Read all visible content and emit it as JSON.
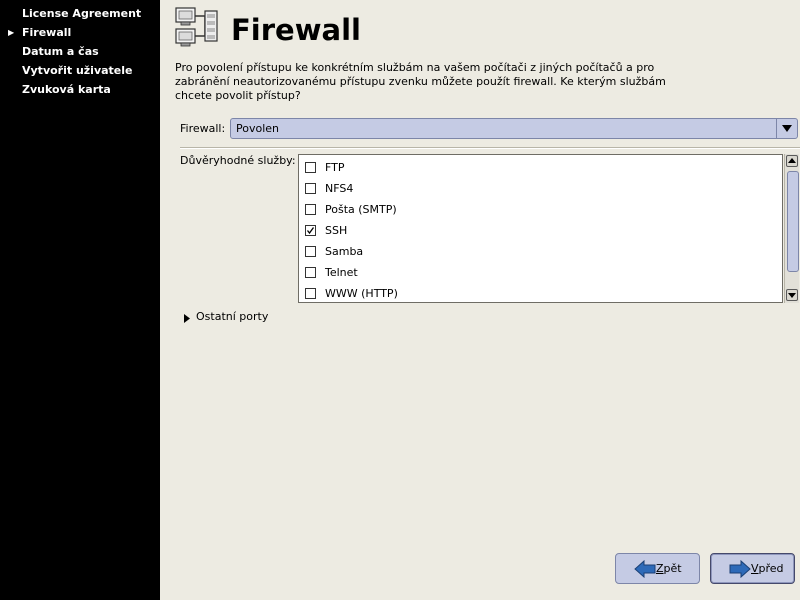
{
  "sidebar": {
    "items": [
      {
        "label": "License Agreement",
        "active": false
      },
      {
        "label": "Firewall",
        "active": true
      },
      {
        "label": "Datum a čas",
        "active": false
      },
      {
        "label": "Vytvořit uživatele",
        "active": false
      },
      {
        "label": "Zvuková karta",
        "active": false
      }
    ]
  },
  "header": {
    "title": "Firewall",
    "icon": "network-firewall-icon"
  },
  "description": "Pro povolení přístupu ke konkrétním službám na vašem počítači z jiných počítačů a pro zabránění neautorizovanému přístupu zvenku můžete použít firewall. Ke kterým službám chcete povolit přístup?",
  "firewall": {
    "label": "Firewall:",
    "value": "Povolen"
  },
  "services": {
    "label": "Důvěryhodné služby:",
    "items": [
      {
        "label": "FTP",
        "checked": false
      },
      {
        "label": "NFS4",
        "checked": false
      },
      {
        "label": "Pošta (SMTP)",
        "checked": false
      },
      {
        "label": "SSH",
        "checked": true
      },
      {
        "label": "Samba",
        "checked": false
      },
      {
        "label": "Telnet",
        "checked": false
      },
      {
        "label": "WWW (HTTP)",
        "checked": false
      }
    ]
  },
  "other_ports": {
    "label": "Ostatní porty",
    "expanded": false
  },
  "buttons": {
    "back": {
      "label_pre": "",
      "mnemonic": "Z",
      "label_post": "pět"
    },
    "next": {
      "label_pre": "",
      "mnemonic": "V",
      "label_post": "před"
    }
  },
  "colors": {
    "sidebar_bg": "#000000",
    "page_bg": "#edebe2",
    "accent": "#c5cbe4",
    "arrow_blue": "#2e6ab8"
  }
}
